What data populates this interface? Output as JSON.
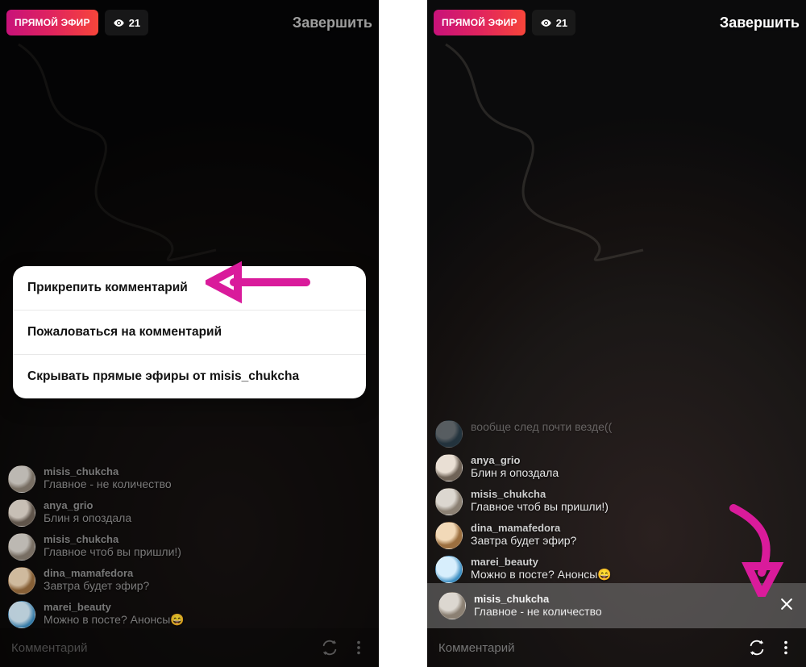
{
  "colors": {
    "live_gradient_start": "#c8127a",
    "live_gradient_end": "#f7453a",
    "annotation": "#d91b9b"
  },
  "left": {
    "live_badge": "ПРЯМОЙ ЭФИР",
    "viewers": "21",
    "end_button": "Завершить",
    "comment_placeholder": "Комментарий",
    "icons": {
      "viewers": "eye-icon",
      "switch_camera": "switch-camera-icon",
      "more": "more-icon"
    },
    "menu": {
      "pin": "Прикрепить комментарий",
      "report": "Пожаловаться на комментарий",
      "hide": "Скрывать прямые эфиры от misis_chukcha"
    },
    "comments": [
      {
        "user": "misis_chukcha",
        "text": "Главное - не количество"
      },
      {
        "user": "anya_grio",
        "text": "Блин я опоздала"
      },
      {
        "user": "misis_chukcha",
        "text": "Главное чтоб вы пришли!)"
      },
      {
        "user": "dina_mamafedora",
        "text": "Завтра будет эфир?"
      },
      {
        "user": "marei_beauty",
        "text": "Можно в посте? Анонсы😄"
      }
    ]
  },
  "right": {
    "live_badge": "ПРЯМОЙ ЭФИР",
    "viewers": "21",
    "end_button": "Завершить",
    "comment_placeholder": "Комментарий",
    "icons": {
      "viewers": "eye-icon",
      "switch_camera": "switch-camera-icon",
      "more": "more-icon",
      "close_pin": "close-icon"
    },
    "faded_comment": {
      "user": "",
      "text": "вообще след почти везде(("
    },
    "comments": [
      {
        "user": "anya_grio",
        "text": "Блин я опоздала"
      },
      {
        "user": "misis_chukcha",
        "text": "Главное чтоб вы пришли!)"
      },
      {
        "user": "dina_mamafedora",
        "text": "Завтра будет эфир?"
      },
      {
        "user": "marei_beauty",
        "text": "Можно в посте? Анонсы😄"
      }
    ],
    "pinned": {
      "user": "misis_chukcha",
      "text": "Главное - не количество"
    }
  }
}
